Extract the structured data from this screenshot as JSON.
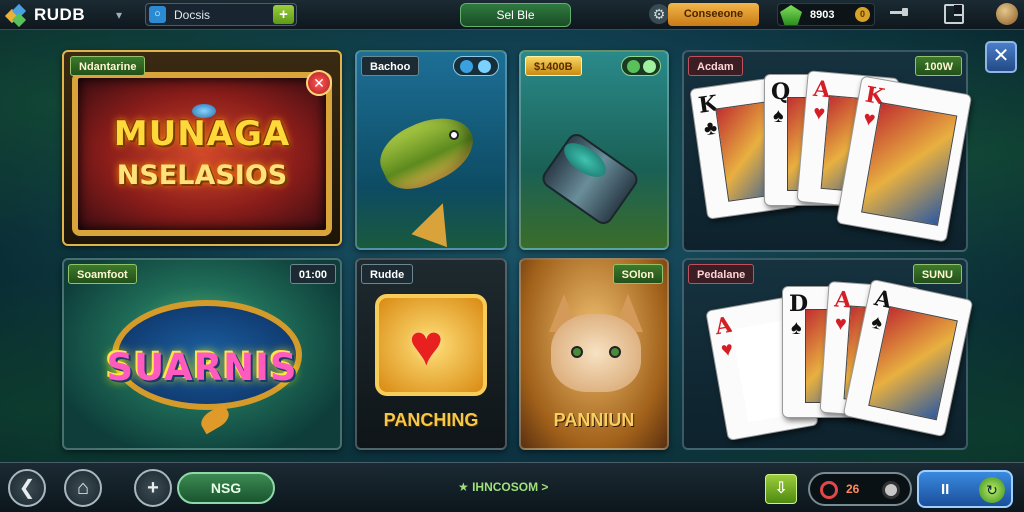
{
  "app": {
    "logo_text": "RUDB",
    "colors": {
      "accent_green": "#5d9a18",
      "accent_gold": "#c97a14",
      "accent_blue": "#234a86",
      "bg": "#0f3a4a"
    }
  },
  "topbar": {
    "search_text": "Docsis",
    "mid_label": "Sel Ble",
    "gold_label": "Conseeone",
    "gem_value": "8903",
    "gem_coin": "0",
    "icons": [
      "chevron-down-icon",
      "search-icon",
      "plus-icon",
      "gear-icon",
      "gem-icon",
      "coin-icon",
      "slider-icon",
      "window-icon",
      "avatar-icon"
    ]
  },
  "tiles": [
    {
      "label": "Ndantarine",
      "title_line1": "MUNAGA",
      "title_line2": "NSELASIOS",
      "badge_icon": "close-icon"
    },
    {
      "label": "Bachoo"
    },
    {
      "label": "$1400B"
    },
    {
      "label": "Acdam",
      "badge": "100W",
      "cards": [
        {
          "rank": "K",
          "suit": "♣"
        },
        {
          "rank": "Q",
          "suit": "♠"
        },
        {
          "rank": "A",
          "suit": "♥"
        },
        {
          "rank": "K",
          "suit": "♥"
        }
      ]
    },
    {
      "label": "Soamfoot",
      "badge": "01:00",
      "title": "SUARNIS"
    },
    {
      "label": "Rudde",
      "title": "PANCHING"
    },
    {
      "label": "SOlon",
      "title": "PANNIUN"
    },
    {
      "label": "Pedalane",
      "badge": "SUNU",
      "cards": [
        {
          "rank": "A",
          "suit": "♥"
        },
        {
          "rank": "D",
          "suit": "♠"
        },
        {
          "rank": "A",
          "suit": "♥"
        },
        {
          "rank": "A",
          "suit": "♠"
        }
      ]
    }
  ],
  "bottombar": {
    "nsg_label": "NSG",
    "ticker": "★ IHNCOSOM >",
    "score_value": "26",
    "play_label": "II"
  }
}
